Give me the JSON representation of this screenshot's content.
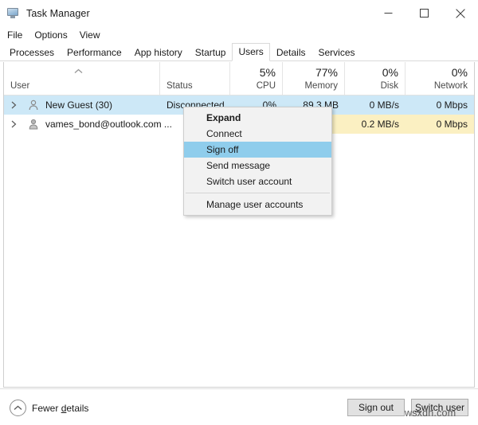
{
  "window": {
    "title": "Task Manager",
    "icon": "task-manager-monitor-icon",
    "controls": {
      "minimize": "minimize-icon",
      "maximize": "maximize-icon",
      "close": "close-icon"
    }
  },
  "menubar": {
    "items": [
      {
        "label": "File"
      },
      {
        "label": "Options"
      },
      {
        "label": "View"
      }
    ]
  },
  "tabs": {
    "active": "Users",
    "items": [
      {
        "label": "Processes"
      },
      {
        "label": "Performance"
      },
      {
        "label": "App history"
      },
      {
        "label": "Startup"
      },
      {
        "label": "Users"
      },
      {
        "label": "Details"
      },
      {
        "label": "Services"
      }
    ]
  },
  "table": {
    "sort": {
      "column": "User",
      "direction": "ascending",
      "icon": "chevron-up-icon"
    },
    "columns": [
      {
        "key": "user",
        "label": "User",
        "pct": "",
        "align": "left"
      },
      {
        "key": "status",
        "label": "Status",
        "pct": "",
        "align": "left"
      },
      {
        "key": "cpu",
        "label": "CPU",
        "pct": "5%",
        "align": "right"
      },
      {
        "key": "memory",
        "label": "Memory",
        "pct": "77%",
        "align": "right"
      },
      {
        "key": "disk",
        "label": "Disk",
        "pct": "0%",
        "align": "right"
      },
      {
        "key": "network",
        "label": "Network",
        "pct": "0%",
        "align": "right"
      }
    ],
    "rows": [
      {
        "user": "New Guest (30)",
        "status": "Disconnected",
        "cpu": "0%",
        "memory": "89.3 MB",
        "disk": "0 MB/s",
        "network": "0 Mbps",
        "selected": true,
        "expander": "chevron-right-icon",
        "avatar": "user-avatar-icon"
      },
      {
        "user": "vames_bond@outlook.com ...",
        "status": "",
        "cpu": "",
        "memory": "",
        "disk": "0.2 MB/s",
        "network": "0 Mbps",
        "selected": false,
        "expander": "chevron-right-icon",
        "avatar": "user-avatar-icon"
      }
    ]
  },
  "context_menu": {
    "items": [
      {
        "label": "Expand",
        "bold": true,
        "highlighted": false,
        "separator_before": false
      },
      {
        "label": "Connect",
        "bold": false,
        "highlighted": false,
        "separator_before": false
      },
      {
        "label": "Sign off",
        "bold": false,
        "highlighted": true,
        "separator_before": false
      },
      {
        "label": "Send message",
        "bold": false,
        "highlighted": false,
        "separator_before": false
      },
      {
        "label": "Switch user account",
        "bold": false,
        "highlighted": false,
        "separator_before": false
      },
      {
        "label": "Manage user accounts",
        "bold": false,
        "highlighted": false,
        "separator_before": true
      }
    ]
  },
  "footer": {
    "fewer_details": "Fewer details",
    "fewer_details_icon": "chevron-up-circle-icon",
    "sign_out": "Sign out",
    "switch_user": "Switch user"
  },
  "watermark": "wsxdn.com",
  "colors": {
    "selection": "#cde8f7",
    "menu_highlight": "#8fcdec",
    "heat_yellow": "#fbf0c2",
    "border": "#cfcfcf"
  }
}
